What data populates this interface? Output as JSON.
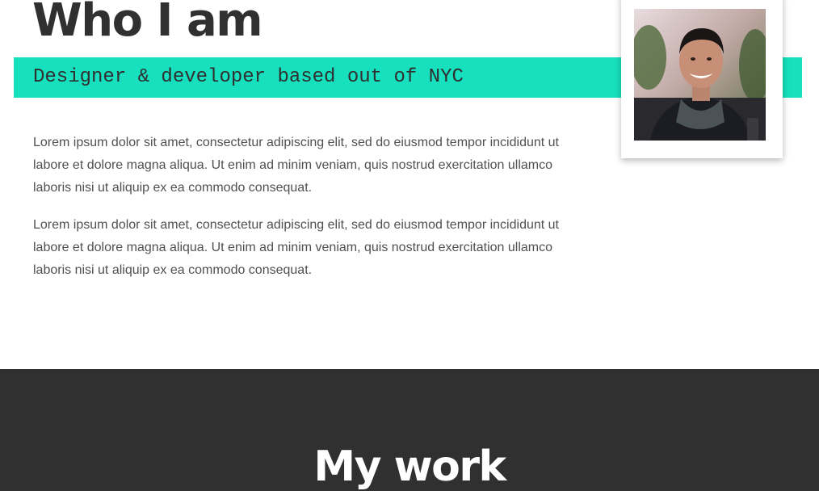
{
  "about": {
    "title": "Who I am",
    "subtitle": "Designer & developer based out of NYC",
    "paragraphs": [
      "Lorem ipsum dolor sit amet, consectetur adipiscing elit, sed do eiusmod tempor incididunt ut labore et dolore magna aliqua. Ut enim ad minim veniam, quis nostrud exercitation ullamco laboris nisi ut aliquip ex ea commodo consequat.",
      "Lorem ipsum dolor sit amet, consectetur adipiscing elit, sed do eiusmod tempor incididunt ut labore et dolore magna aliqua. Ut enim ad minim veniam, quis nostrud exercitation ullamco laboris nisi ut aliquip ex ea commodo consequat."
    ],
    "photo_icon": "profile-photo"
  },
  "work": {
    "title": "My work"
  },
  "colors": {
    "accent": "#16e0bd",
    "dark": "#303030",
    "text": "#505050",
    "background": "#ffffff"
  }
}
